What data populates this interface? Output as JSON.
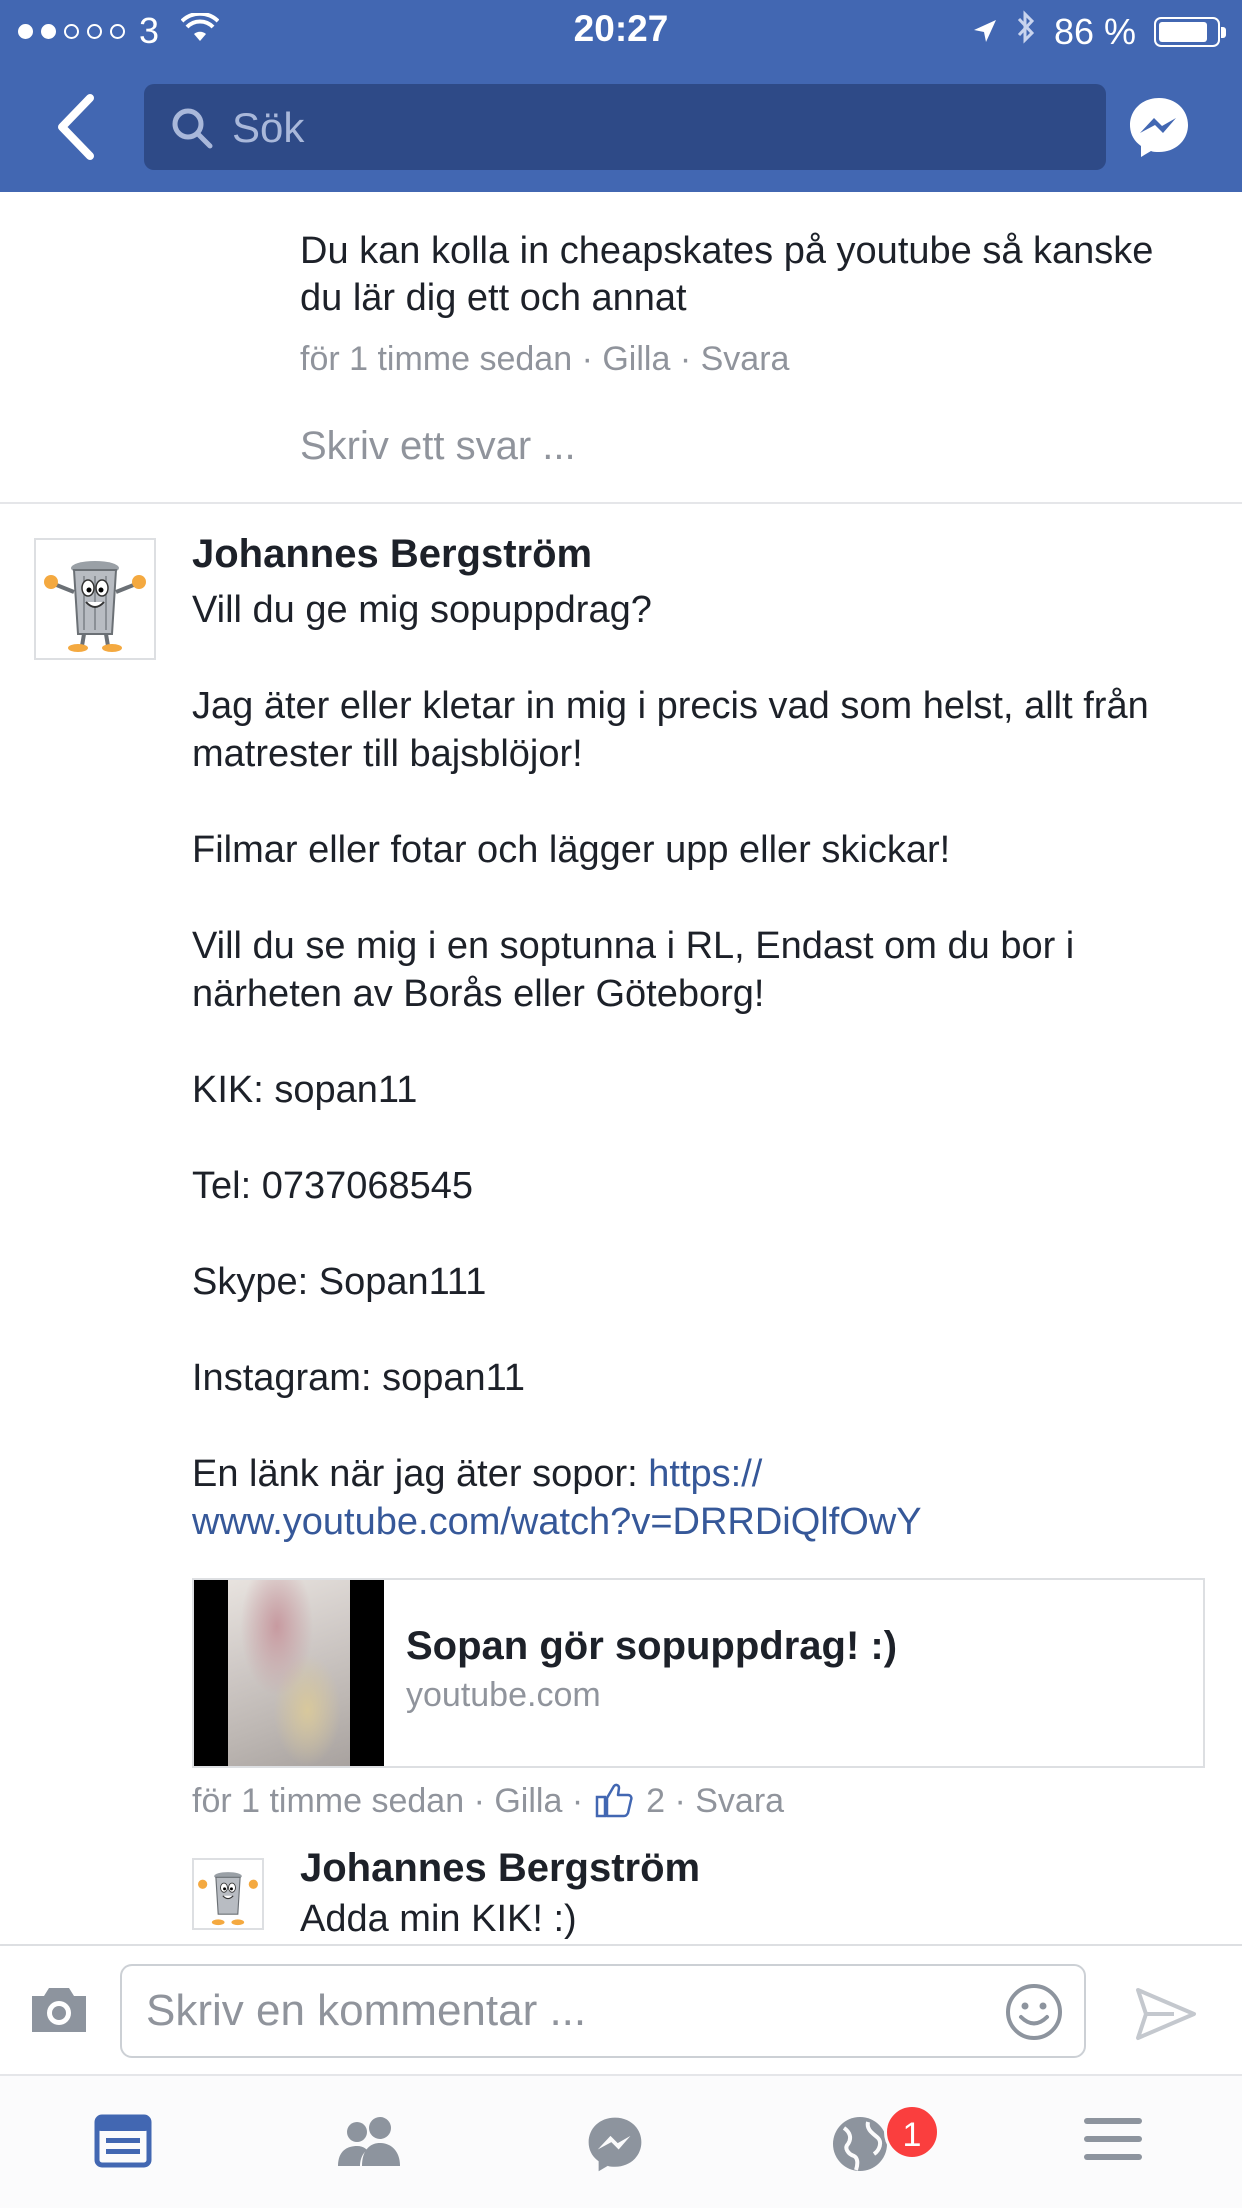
{
  "status_bar": {
    "carrier": "3",
    "time": "20:27",
    "battery_percent": "86 %",
    "battery_level": 0.86
  },
  "header": {
    "search_placeholder": "Sök"
  },
  "previous_reply": {
    "text": "Du kan kolla in cheapskates på youtube så kanske du lär dig ett och annat",
    "time": "för 1 timme sedan",
    "like_label": "Gilla",
    "reply_label": "Svara",
    "write_reply_placeholder": "Skriv ett svar ..."
  },
  "comment": {
    "author": "Johannes Bergström",
    "paragraphs": [
      "Vill du ge mig sopuppdrag?",
      "Jag äter eller kletar in mig i precis vad som helst, allt från matrester till bajsblöjor!",
      "Filmar eller fotar och lägger upp eller skickar!",
      "Vill du se mig i en soptunna i RL, Endast om du bor i närheten av Borås eller Göteborg!",
      "KIK: sopan11",
      "Tel: 0737068545",
      "Skype: Sopan111",
      "Instagram: sopan11"
    ],
    "link_intro": "En länk när jag äter sopor: ",
    "link_url_line1": "https://",
    "link_url_line2": "www.youtube.com/watch?v=DRRDiQlfOwY",
    "link_card": {
      "title": "Sopan gör sopuppdrag! :)",
      "domain": "youtube.com"
    },
    "time": "för 1 timme sedan",
    "like_label": "Gilla",
    "like_count": "2",
    "reply_label": "Svara"
  },
  "nested_reply": {
    "author": "Johannes Bergström",
    "text": "Adda min KIK! :)"
  },
  "composer": {
    "placeholder": "Skriv en kommentar ..."
  },
  "tabbar": {
    "notifications_badge": "1"
  },
  "colors": {
    "brand": "#4267b2",
    "link": "#365899",
    "meta": "#90949c",
    "badge": "#fa3e3e"
  }
}
